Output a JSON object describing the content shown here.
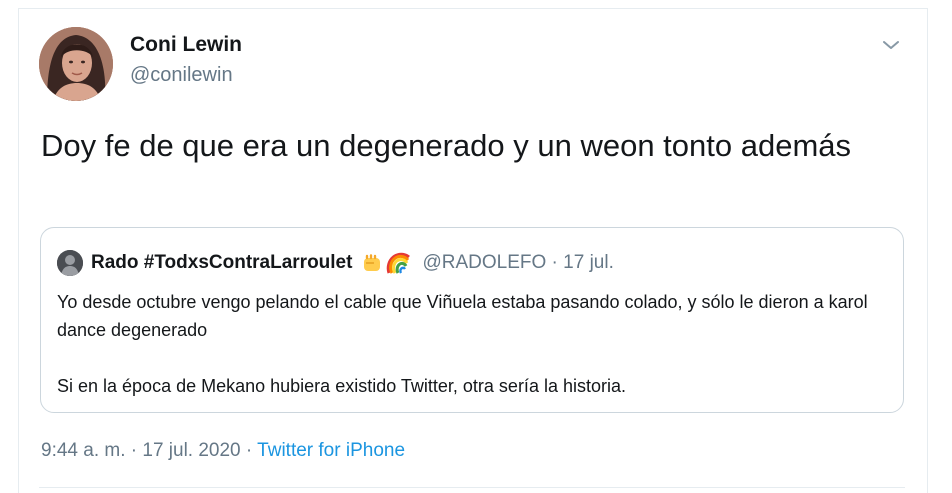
{
  "tweet": {
    "author": {
      "name": "Coni Lewin",
      "handle": "@conilewin"
    },
    "text": "Doy fe de que era un degenerado y un weon tonto además",
    "quoted": {
      "author_name": "Rado #TodxsContraLarroulet",
      "emojis": [
        "fist-icon",
        "rainbow-icon"
      ],
      "meta": "@RADOLEFO · 17 jul.",
      "paragraphs": [
        "Yo desde octubre vengo pelando el cable que Viñuela estaba pasando colado, y sólo le dieron a karol dance degenerado",
        "Si en la época de Mekano hubiera existido Twitter, otra sería la historia."
      ]
    },
    "timestamp": "9:44 a. m. · 17 jul. 2020 · ",
    "source": "Twitter for iPhone"
  },
  "colors": {
    "text": "#14171a",
    "secondary": "#657786",
    "link": "#1b95e0",
    "border": "#ccd6dd"
  }
}
